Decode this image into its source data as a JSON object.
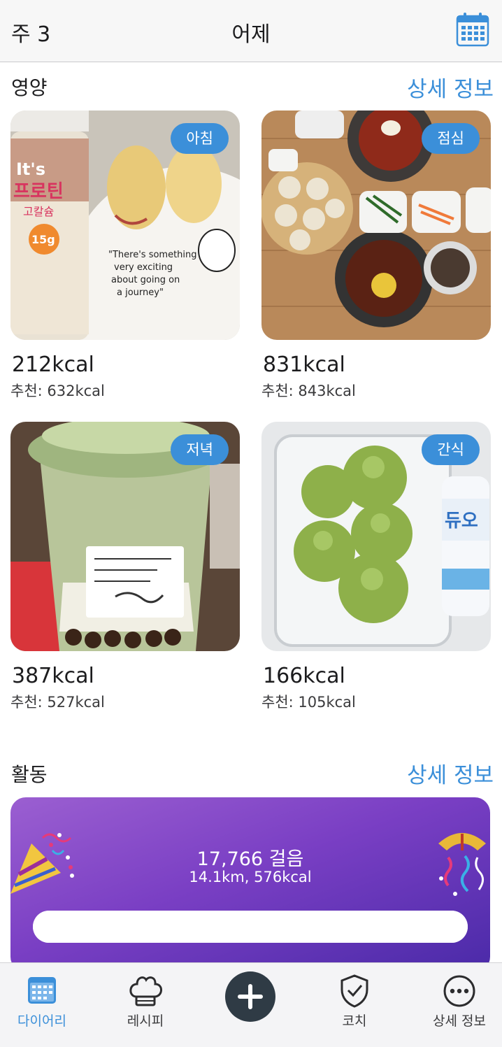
{
  "header": {
    "week": "주 3",
    "title": "어제"
  },
  "nutrition": {
    "title": "영양",
    "details_label": "상세 정보",
    "meals": [
      {
        "badge": "아침",
        "kcal": "212kcal",
        "recommended": "추천: 632kcal"
      },
      {
        "badge": "점심",
        "kcal": "831kcal",
        "recommended": "추천: 843kcal"
      },
      {
        "badge": "저녁",
        "kcal": "387kcal",
        "recommended": "추천: 527kcal"
      },
      {
        "badge": "간식",
        "kcal": "166kcal",
        "recommended": "추천: 105kcal"
      }
    ]
  },
  "activity": {
    "title": "활동",
    "details_label": "상세 정보",
    "steps": "17,766 걸음",
    "distance_kcal": "14.1km, 576kcal",
    "progress_fraction": 1.0
  },
  "tabbar": {
    "tabs": [
      {
        "label": "다이어리",
        "icon": "calendar-icon",
        "active": true
      },
      {
        "label": "레시피",
        "icon": "chef-hat-icon",
        "active": false
      },
      {
        "label": "",
        "icon": "plus-icon",
        "active": false
      },
      {
        "label": "코치",
        "icon": "shield-check-icon",
        "active": false
      },
      {
        "label": "상세 정보",
        "icon": "more-icon",
        "active": false
      }
    ]
  },
  "colors": {
    "accent": "#3b8fd9",
    "fab": "#2f3b45",
    "activity_start": "#9b5fd1",
    "activity_end": "#4a2aa8"
  }
}
